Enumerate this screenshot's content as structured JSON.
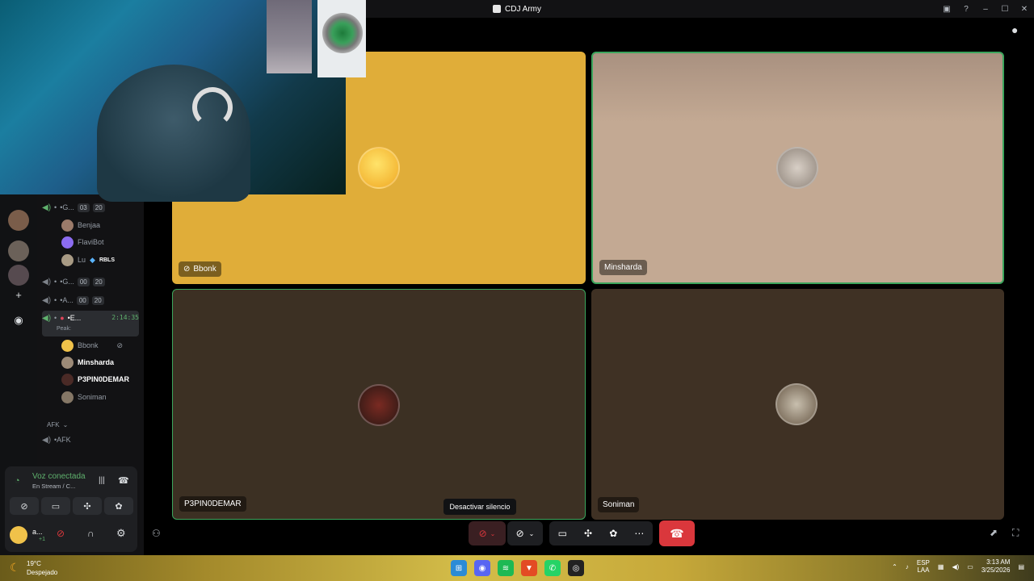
{
  "window": {
    "title": "CDJ Army"
  },
  "channels": {
    "rows": [
      {
        "label": "•G...",
        "prefix": "•",
        "count_a": "03",
        "count_b": "20"
      },
      {
        "label": "•G...",
        "prefix": "•",
        "count_a": "00",
        "count_b": "20"
      },
      {
        "label": "•A...",
        "prefix": "•",
        "count_a": "00",
        "count_b": "20"
      },
      {
        "label": "•E...",
        "prefix": "•",
        "time": "2:14:35",
        "sub": "Peak:"
      }
    ],
    "users_first": [
      {
        "name": "Benjaa"
      },
      {
        "name": "FlaviBot"
      },
      {
        "name": "Lu",
        "tag": "RBLS"
      }
    ],
    "users_second": [
      {
        "name": "Bbonk"
      },
      {
        "name": "Minsharda"
      },
      {
        "name": "P3PIN0DEMAR"
      },
      {
        "name": "Soniman"
      }
    ],
    "afk_category": "AFK",
    "afk_channel": "•AFK"
  },
  "voice_panel": {
    "status": "Voz conectada",
    "substatus": "En Stream / C...",
    "user_short": "a...",
    "user_sub": "+1"
  },
  "tiles": [
    {
      "name": "Bbonk",
      "bg": "#e0ad39"
    },
    {
      "name": "Minsharda",
      "bg": "#c3a993"
    },
    {
      "name": "P3PIN0DEMAR",
      "bg": "#3c3023"
    },
    {
      "name": "Soniman",
      "bg": "#3f3124"
    }
  ],
  "toolbar": {
    "tooltip": "Desactivar silencio"
  },
  "taskbar": {
    "weather_temp": "19°C",
    "weather_desc": "Despejado",
    "lang": "ESP",
    "lang_sub": "LAA",
    "time": "3:13 AM",
    "date": "3/25/2026"
  }
}
